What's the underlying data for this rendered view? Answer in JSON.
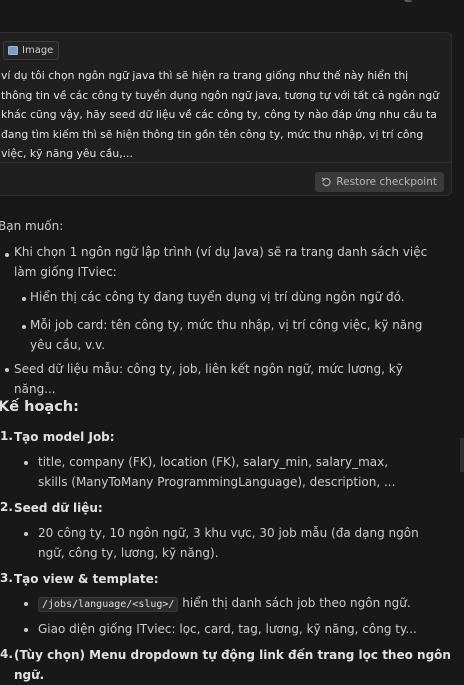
{
  "user_message": {
    "attachment_label": "Image",
    "text": "ví dụ tôi chọn ngôn ngữ java thì sẽ hiện ra trang giống như thế này hiển thị thông tin về các công ty tuyển dụng ngôn ngữ java, tương tự với tất cả ngôn ngữ khác cũng vậy, hãy seed dữ liệu về các công ty, công ty nào đáp ứng nhu cầu ta đang tìm kiếm thì sẽ hiện thông tin gồn tên công ty, mức thu nhập, vị trí công việc, kỹ năng yêu cầu,...",
    "restore_label": "Restore checkpoint"
  },
  "reply": {
    "intro": "Bạn muốn:",
    "wants": [
      "Khi chọn 1 ngôn ngữ lập trình (ví dụ Java) sẽ ra trang danh sách việc làm giống ITviec:",
      "Hiển thị các công ty đang tuyển dụng vị trí dùng ngôn ngữ đó.",
      "Mỗi job card: tên công ty, mức thu nhập, vị trí công việc, kỹ năng yêu cầu, v.v.",
      "Seed dữ liệu mẫu: công ty, job, liên kết ngôn ngữ, mức lương, kỹ năng..."
    ],
    "plan_heading": "Kế hoạch:",
    "plan": [
      {
        "num": "1.",
        "title": "Tạo model Job:",
        "detail": "title, company (FK), location (FK), salary_min, salary_max, skills (ManyToMany ProgrammingLanguage), description, ..."
      },
      {
        "num": "2.",
        "title": "Seed dữ liệu:",
        "detail": "20 công ty, 10 ngôn ngữ, 3 khu vực, 30 job mẫu (đa dạng ngôn ngữ, công ty, lương, kỹ năng)."
      },
      {
        "num": "3.",
        "title": "Tạo view & template:",
        "code": "/jobs/language/<slug>/",
        "code_suffix": "hiển thị danh sách job theo ngôn ngữ.",
        "detail2": "Giao diện giống ITviec: lọc, card, tag, lương, kỹ năng, công ty..."
      },
      {
        "num": "4.",
        "title": "(Tùy chọn) Menu dropdown tự động link đến trang lọc theo ngôn ngữ."
      }
    ]
  }
}
